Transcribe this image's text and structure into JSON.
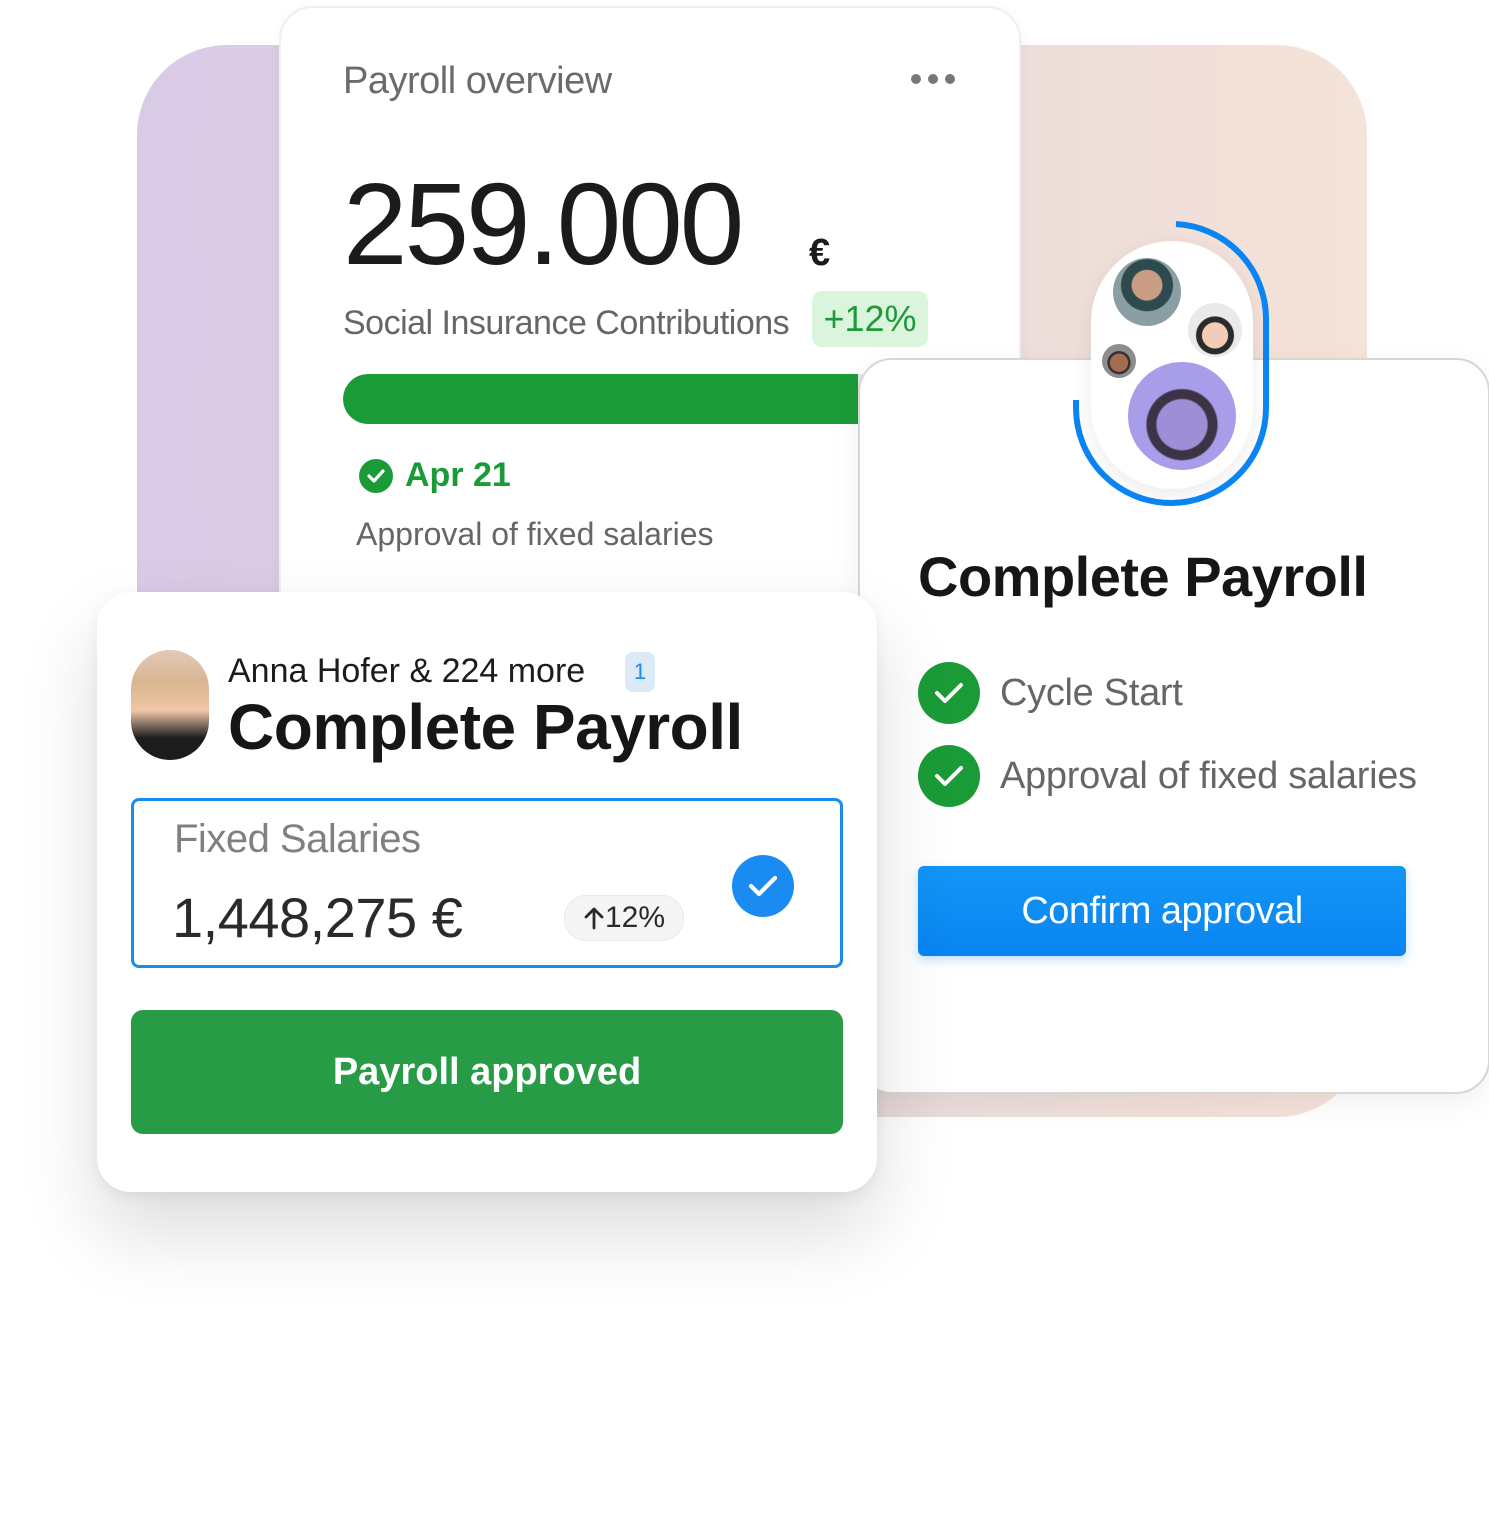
{
  "overview": {
    "title": "Payroll overview",
    "menu_icon": "more-horizontal-icon",
    "amount": "259.000",
    "currency": "€",
    "metric_label": "Social Insurance Contributions",
    "metric_change": "+12%",
    "progress_percent": 78,
    "milestone_date": "Apr 21",
    "milestone_description": "Approval of fixed salaries",
    "colors": {
      "green": "#1b9b38",
      "badge_bg": "#daf5dc"
    }
  },
  "confirm_card": {
    "title": "Complete Payroll",
    "avatars": [
      "avatar-man-cap",
      "avatar-woman-bun",
      "avatar-man-small",
      "avatar-woman-purple"
    ],
    "steps": [
      {
        "label": "Cycle Start",
        "status": "done"
      },
      {
        "label": "Approval of fixed salaries",
        "status": "done"
      }
    ],
    "confirm_button": "Confirm approval",
    "colors": {
      "blue": "#0a84f2"
    }
  },
  "approval_card": {
    "assignee": "Anna Hofer & 224 more",
    "notification_count": "1",
    "title": "Complete Payroll",
    "salary_label": "Fixed Salaries",
    "salary_amount": "1,448,275 €",
    "salary_change": "12%",
    "selected": true,
    "approved_button": "Payroll approved",
    "colors": {
      "green": "#279b45",
      "blue": "#1a8bf0"
    }
  }
}
